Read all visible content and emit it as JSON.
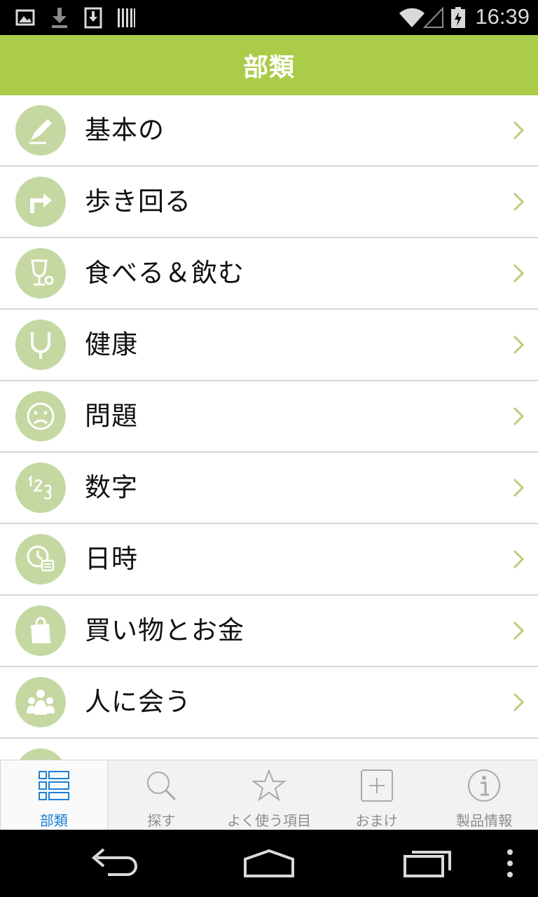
{
  "status_bar": {
    "time": "16:39",
    "icons": [
      "picture-icon",
      "download-icon",
      "download-box-icon",
      "barcode-icon",
      "wifi-icon",
      "signal-icon",
      "battery-icon"
    ]
  },
  "header": {
    "title": "部類"
  },
  "categories": [
    {
      "label": "基本の",
      "icon": "pencil-icon"
    },
    {
      "label": "歩き回る",
      "icon": "turn-right-arrow-icon"
    },
    {
      "label": "食べる＆飲む",
      "icon": "glass-icon"
    },
    {
      "label": "健康",
      "icon": "stethoscope-icon"
    },
    {
      "label": "問題",
      "icon": "sad-face-icon"
    },
    {
      "label": "数字",
      "icon": "numbers-icon"
    },
    {
      "label": "日時",
      "icon": "clock-calendar-icon"
    },
    {
      "label": "買い物とお金",
      "icon": "shopping-bag-icon"
    },
    {
      "label": "人に会う",
      "icon": "people-icon"
    }
  ],
  "tabs": [
    {
      "label": "部類",
      "icon": "list-grid-icon",
      "active": true
    },
    {
      "label": "探す",
      "icon": "search-icon",
      "active": false
    },
    {
      "label": "よく使う項目",
      "icon": "star-icon",
      "active": false
    },
    {
      "label": "おまけ",
      "icon": "plus-box-icon",
      "active": false
    },
    {
      "label": "製品情報",
      "icon": "info-icon",
      "active": false
    }
  ],
  "colors": {
    "header_bg": "#abcc4a",
    "icon_circle": "#c6d8a2",
    "chevron": "#b7cf7a",
    "active_tab": "#1d7fd6",
    "inactive_tab": "#8c8c8c"
  }
}
